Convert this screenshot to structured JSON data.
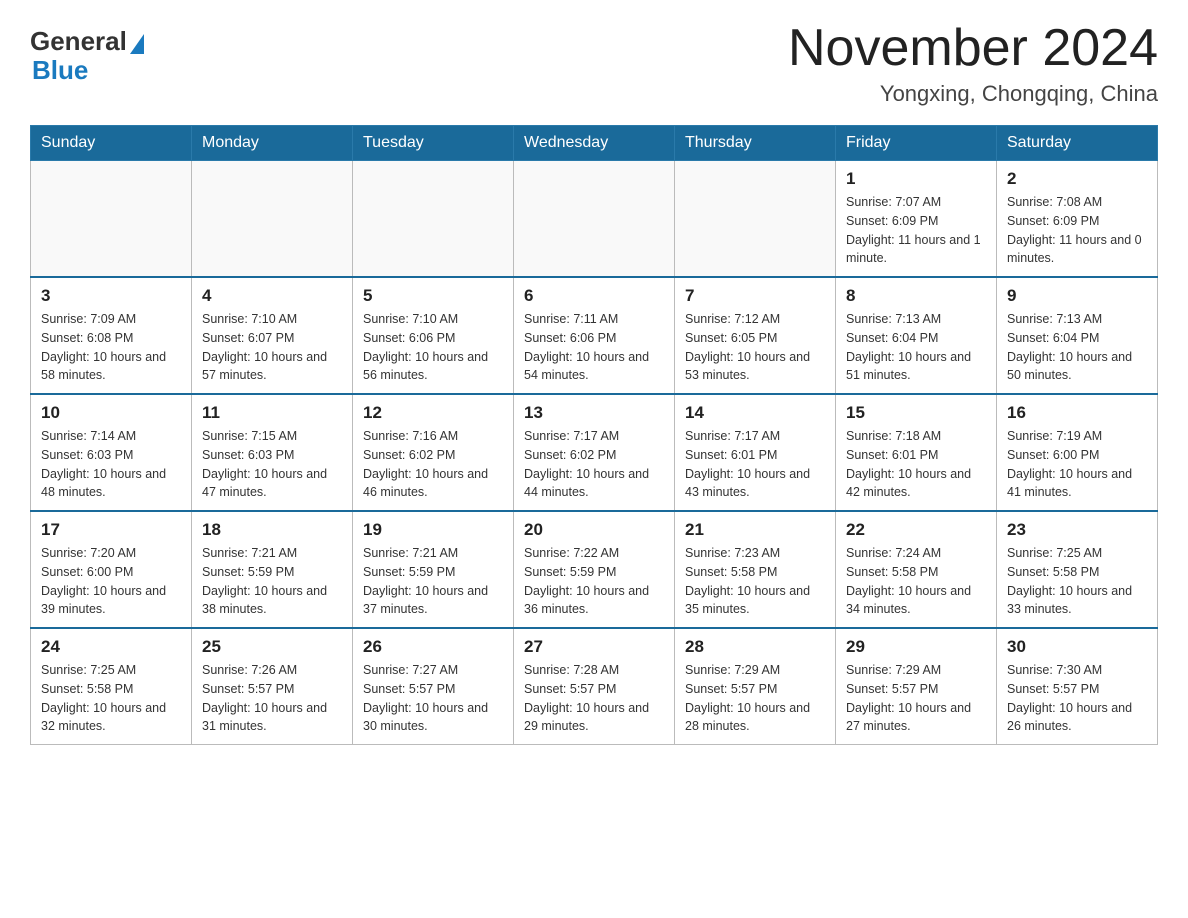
{
  "logo": {
    "general": "General",
    "blue": "Blue"
  },
  "title": "November 2024",
  "subtitle": "Yongxing, Chongqing, China",
  "weekdays": [
    "Sunday",
    "Monday",
    "Tuesday",
    "Wednesday",
    "Thursday",
    "Friday",
    "Saturday"
  ],
  "weeks": [
    [
      {
        "day": "",
        "info": ""
      },
      {
        "day": "",
        "info": ""
      },
      {
        "day": "",
        "info": ""
      },
      {
        "day": "",
        "info": ""
      },
      {
        "day": "",
        "info": ""
      },
      {
        "day": "1",
        "info": "Sunrise: 7:07 AM\nSunset: 6:09 PM\nDaylight: 11 hours and 1 minute."
      },
      {
        "day": "2",
        "info": "Sunrise: 7:08 AM\nSunset: 6:09 PM\nDaylight: 11 hours and 0 minutes."
      }
    ],
    [
      {
        "day": "3",
        "info": "Sunrise: 7:09 AM\nSunset: 6:08 PM\nDaylight: 10 hours and 58 minutes."
      },
      {
        "day": "4",
        "info": "Sunrise: 7:10 AM\nSunset: 6:07 PM\nDaylight: 10 hours and 57 minutes."
      },
      {
        "day": "5",
        "info": "Sunrise: 7:10 AM\nSunset: 6:06 PM\nDaylight: 10 hours and 56 minutes."
      },
      {
        "day": "6",
        "info": "Sunrise: 7:11 AM\nSunset: 6:06 PM\nDaylight: 10 hours and 54 minutes."
      },
      {
        "day": "7",
        "info": "Sunrise: 7:12 AM\nSunset: 6:05 PM\nDaylight: 10 hours and 53 minutes."
      },
      {
        "day": "8",
        "info": "Sunrise: 7:13 AM\nSunset: 6:04 PM\nDaylight: 10 hours and 51 minutes."
      },
      {
        "day": "9",
        "info": "Sunrise: 7:13 AM\nSunset: 6:04 PM\nDaylight: 10 hours and 50 minutes."
      }
    ],
    [
      {
        "day": "10",
        "info": "Sunrise: 7:14 AM\nSunset: 6:03 PM\nDaylight: 10 hours and 48 minutes."
      },
      {
        "day": "11",
        "info": "Sunrise: 7:15 AM\nSunset: 6:03 PM\nDaylight: 10 hours and 47 minutes."
      },
      {
        "day": "12",
        "info": "Sunrise: 7:16 AM\nSunset: 6:02 PM\nDaylight: 10 hours and 46 minutes."
      },
      {
        "day": "13",
        "info": "Sunrise: 7:17 AM\nSunset: 6:02 PM\nDaylight: 10 hours and 44 minutes."
      },
      {
        "day": "14",
        "info": "Sunrise: 7:17 AM\nSunset: 6:01 PM\nDaylight: 10 hours and 43 minutes."
      },
      {
        "day": "15",
        "info": "Sunrise: 7:18 AM\nSunset: 6:01 PM\nDaylight: 10 hours and 42 minutes."
      },
      {
        "day": "16",
        "info": "Sunrise: 7:19 AM\nSunset: 6:00 PM\nDaylight: 10 hours and 41 minutes."
      }
    ],
    [
      {
        "day": "17",
        "info": "Sunrise: 7:20 AM\nSunset: 6:00 PM\nDaylight: 10 hours and 39 minutes."
      },
      {
        "day": "18",
        "info": "Sunrise: 7:21 AM\nSunset: 5:59 PM\nDaylight: 10 hours and 38 minutes."
      },
      {
        "day": "19",
        "info": "Sunrise: 7:21 AM\nSunset: 5:59 PM\nDaylight: 10 hours and 37 minutes."
      },
      {
        "day": "20",
        "info": "Sunrise: 7:22 AM\nSunset: 5:59 PM\nDaylight: 10 hours and 36 minutes."
      },
      {
        "day": "21",
        "info": "Sunrise: 7:23 AM\nSunset: 5:58 PM\nDaylight: 10 hours and 35 minutes."
      },
      {
        "day": "22",
        "info": "Sunrise: 7:24 AM\nSunset: 5:58 PM\nDaylight: 10 hours and 34 minutes."
      },
      {
        "day": "23",
        "info": "Sunrise: 7:25 AM\nSunset: 5:58 PM\nDaylight: 10 hours and 33 minutes."
      }
    ],
    [
      {
        "day": "24",
        "info": "Sunrise: 7:25 AM\nSunset: 5:58 PM\nDaylight: 10 hours and 32 minutes."
      },
      {
        "day": "25",
        "info": "Sunrise: 7:26 AM\nSunset: 5:57 PM\nDaylight: 10 hours and 31 minutes."
      },
      {
        "day": "26",
        "info": "Sunrise: 7:27 AM\nSunset: 5:57 PM\nDaylight: 10 hours and 30 minutes."
      },
      {
        "day": "27",
        "info": "Sunrise: 7:28 AM\nSunset: 5:57 PM\nDaylight: 10 hours and 29 minutes."
      },
      {
        "day": "28",
        "info": "Sunrise: 7:29 AM\nSunset: 5:57 PM\nDaylight: 10 hours and 28 minutes."
      },
      {
        "day": "29",
        "info": "Sunrise: 7:29 AM\nSunset: 5:57 PM\nDaylight: 10 hours and 27 minutes."
      },
      {
        "day": "30",
        "info": "Sunrise: 7:30 AM\nSunset: 5:57 PM\nDaylight: 10 hours and 26 minutes."
      }
    ]
  ]
}
